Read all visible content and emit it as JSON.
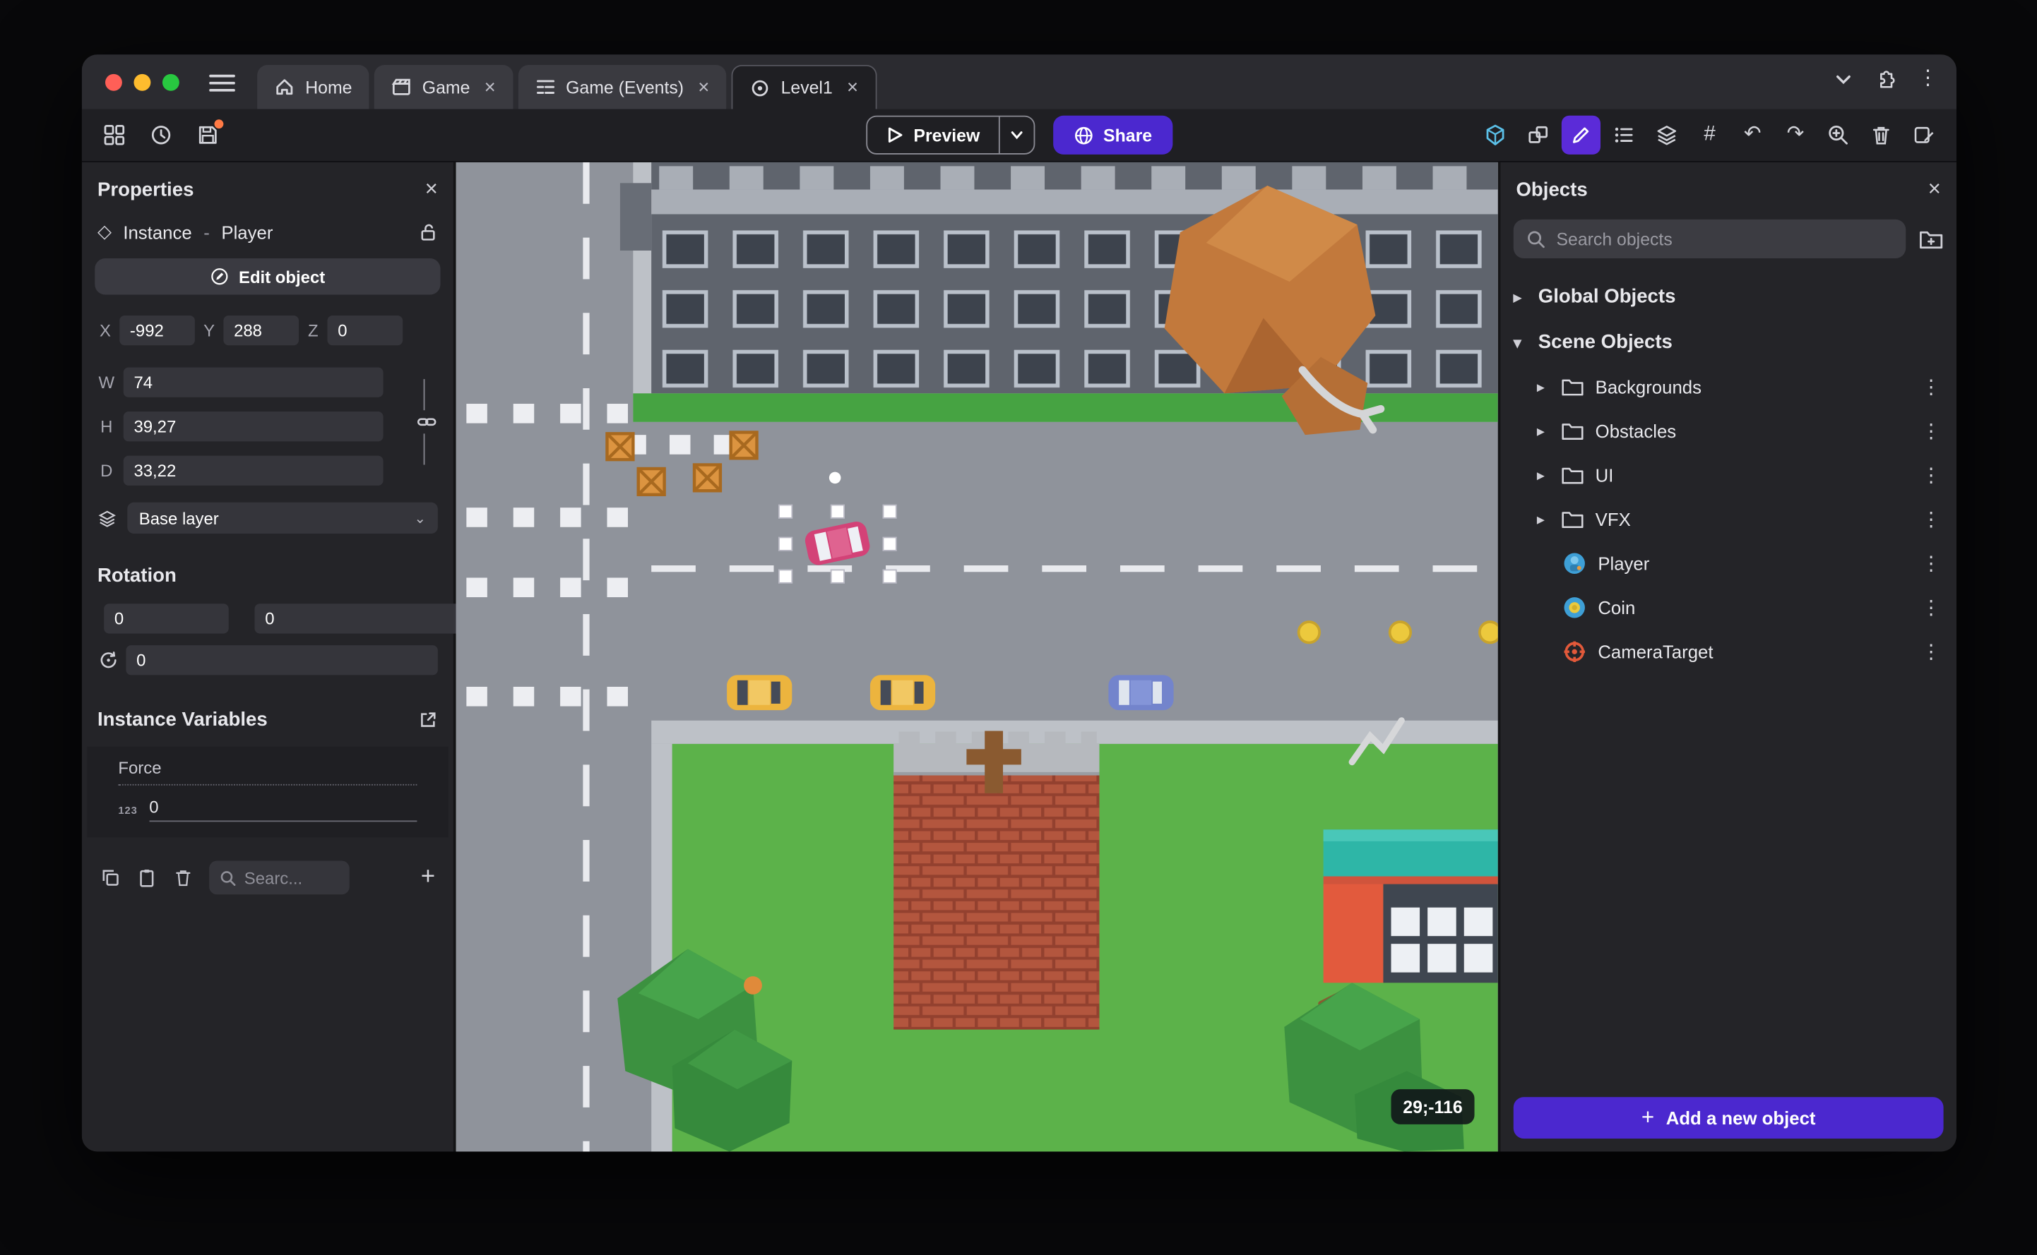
{
  "window": {
    "traffic_lights": {
      "close": "#ff5f57",
      "minimize": "#febc2e",
      "zoom": "#28c840"
    },
    "tabs": [
      {
        "label": "Home",
        "closable": false,
        "active": false
      },
      {
        "label": "Game",
        "closable": true,
        "active": false
      },
      {
        "label": "Game (Events)",
        "closable": true,
        "active": false
      },
      {
        "label": "Level1",
        "closable": true,
        "active": true
      }
    ]
  },
  "toolbar": {
    "preview_label": "Preview",
    "share_label": "Share"
  },
  "properties_panel": {
    "title": "Properties",
    "instance_label": "Instance",
    "separator": "-",
    "instance_name": "Player",
    "edit_object_label": "Edit object",
    "position": {
      "x_label": "X",
      "x_value": "-992",
      "y_label": "Y",
      "y_value": "288",
      "z_label": "Z",
      "z_value": "0"
    },
    "size": {
      "w_label": "W",
      "w_value": "74",
      "h_label": "H",
      "h_value": "39,27",
      "d_label": "D",
      "d_value": "33,22"
    },
    "layer_value": "Base layer",
    "rotation_title": "Rotation",
    "rotation": {
      "rx_value": "0",
      "ry_value": "0",
      "rz_value": "0"
    },
    "instance_variables_title": "Instance Variables",
    "variable_name": "Force",
    "variable_type_label": "123",
    "variable_value": "0",
    "search_placeholder": "Searc..."
  },
  "scene": {
    "coords_badge": "29;-116"
  },
  "objects_panel": {
    "title": "Objects",
    "search_placeholder": "Search objects",
    "global_group_label": "Global Objects",
    "scene_group_label": "Scene Objects",
    "folders": [
      {
        "label": "Backgrounds"
      },
      {
        "label": "Obstacles"
      },
      {
        "label": "UI"
      },
      {
        "label": "VFX"
      }
    ],
    "objects": [
      {
        "label": "Player"
      },
      {
        "label": "Coin"
      },
      {
        "label": "CameraTarget"
      }
    ],
    "add_button_label": "Add a new object"
  },
  "colors": {
    "accent_purple": "#4b28cf",
    "active_tool_purple": "#5b2bd8",
    "selection_white": "#ffffff",
    "save_badge_orange": "#ff7a45",
    "cube_tool_blue": "#5bc0e8"
  }
}
